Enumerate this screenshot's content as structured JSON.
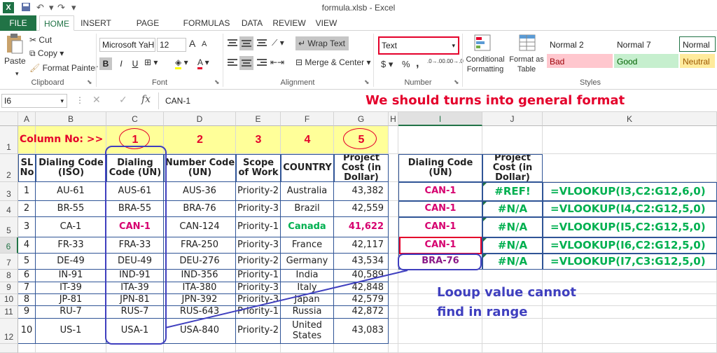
{
  "window": {
    "title": "formula.xlsb - Excel",
    "logo": "X"
  },
  "tabs": [
    "FILE",
    "HOME",
    "INSERT",
    "PAGE LAYOUT",
    "FORMULAS",
    "DATA",
    "REVIEW",
    "VIEW"
  ],
  "ribbon": {
    "clipboard": {
      "paste": "Paste",
      "cut": "Cut",
      "copy": "Copy",
      "format_painter": "Format Painter",
      "label": "Clipboard"
    },
    "font": {
      "name": "Microsoft YaH",
      "size": "12",
      "bold": "B",
      "italic": "I",
      "underline": "U",
      "label": "Font",
      "grow": "A",
      "shrink": "A",
      "font_color": "A"
    },
    "alignment": {
      "wrap": "Wrap Text",
      "merge": "Merge & Center",
      "label": "Alignment"
    },
    "number": {
      "format": "Text",
      "label": "Number",
      "currency": "$",
      "percent": "%",
      "comma": ",",
      "inc_dec": ".0→.00",
      "dec_dec": ".00→.0"
    },
    "styles": {
      "conditional": "Conditional Formatting",
      "format_table": "Format as Table",
      "label": "Styles",
      "cells": [
        "Normal 2",
        "Normal 7",
        "Normal",
        "Bad",
        "Good",
        "Neutral"
      ]
    }
  },
  "formula_bar": {
    "name_box": "I6",
    "fx": "fx",
    "value": "CAN-1",
    "annotation": "We should turns into general format"
  },
  "columns": [
    "A",
    "B",
    "C",
    "D",
    "E",
    "F",
    "G",
    "H",
    "I",
    "J",
    "K"
  ],
  "rows": [
    "1",
    "2",
    "3",
    "4",
    "5",
    "6",
    "7",
    "8",
    "9",
    "10",
    "11",
    "12"
  ],
  "row1": {
    "label": "Column No: >>",
    "nums": [
      "1",
      "2",
      "3",
      "4",
      "5"
    ]
  },
  "headers": [
    "SL No",
    "Dialing Code (ISO)",
    "Dialing Code (UN)",
    "Number Code (UN)",
    "Scope of Work",
    "COUNTRY",
    "Project Cost (in Dollar)"
  ],
  "data": [
    [
      "1",
      "AU-61",
      "AUS-61",
      "AUS-36",
      "Priority-2",
      "Australia",
      "43,382"
    ],
    [
      "2",
      "BR-55",
      "BRA-55",
      "BRA-76",
      "Priority-3",
      "Brazil",
      "42,559"
    ],
    [
      "3",
      "CA-1",
      "CAN-1",
      "CAN-124",
      "Priority-1",
      "Canada",
      "41,622"
    ],
    [
      "4",
      "FR-33",
      "FRA-33",
      "FRA-250",
      "Priority-3",
      "France",
      "42,117"
    ],
    [
      "5",
      "DE-49",
      "DEU-49",
      "DEU-276",
      "Priority-2",
      "Germany",
      "43,534"
    ],
    [
      "6",
      "IN-91",
      "IND-91",
      "IND-356",
      "Priority-1",
      "India",
      "40,589"
    ],
    [
      "7",
      "IT-39",
      "ITA-39",
      "ITA-380",
      "Priority-3",
      "Italy",
      "42,848"
    ],
    [
      "8",
      "JP-81",
      "JPN-81",
      "JPN-392",
      "Priority-3",
      "Japan",
      "42,579"
    ],
    [
      "9",
      "RU-7",
      "RUS-7",
      "RUS-643",
      "Priority-1",
      "Russia",
      "42,872"
    ],
    [
      "10",
      "US-1",
      "USA-1",
      "USA-840",
      "Priority-2",
      "United States",
      "43,083"
    ]
  ],
  "lookup": {
    "headers": [
      "Dialing Code (UN)",
      "Project Cost (in Dollar)"
    ],
    "rows": [
      [
        "CAN-1",
        "#REF!",
        "=VLOOKUP(I3,C2:G12,6,0)"
      ],
      [
        "CAN-1",
        "#N/A",
        "=VLOOKUP(I4,C2:G12,5,0)"
      ],
      [
        "CAN-1",
        "#N/A",
        "=VLOOKUP(I5,C2:G12,5,0)"
      ],
      [
        "CAN-1",
        "#N/A",
        "=VLOOKUP(I6,C2:G12,5,0)"
      ],
      [
        "BRA-76",
        "#N/A",
        "=VLOOKUP(I7,C3:G12,5,0)"
      ]
    ],
    "note": "Looup value cannot find in range"
  }
}
